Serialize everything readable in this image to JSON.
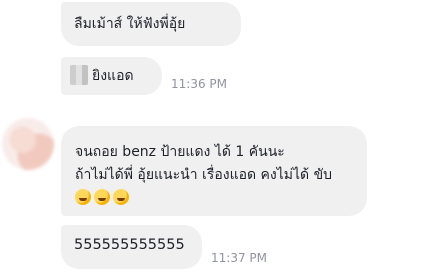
{
  "messages": [
    {
      "text": "ลืมเม้าส์ ให้ฟังพี่อุ้ย"
    },
    {
      "text": "ยิงแอด",
      "time": "11:36 PM"
    },
    {
      "line1": "จนถอย benz ป้ายแดง ได้ 1 คันนะ",
      "line2": "ถ้าไม่ได้พี่ อุ้ยแนะนำ เรื่องแอด คงไม่ได้ ขับ"
    },
    {
      "text": "555555555555",
      "time": "11:37 PM"
    }
  ],
  "icons": {
    "emoji": "laughing-face-icon",
    "avatar": "sender-avatar"
  }
}
